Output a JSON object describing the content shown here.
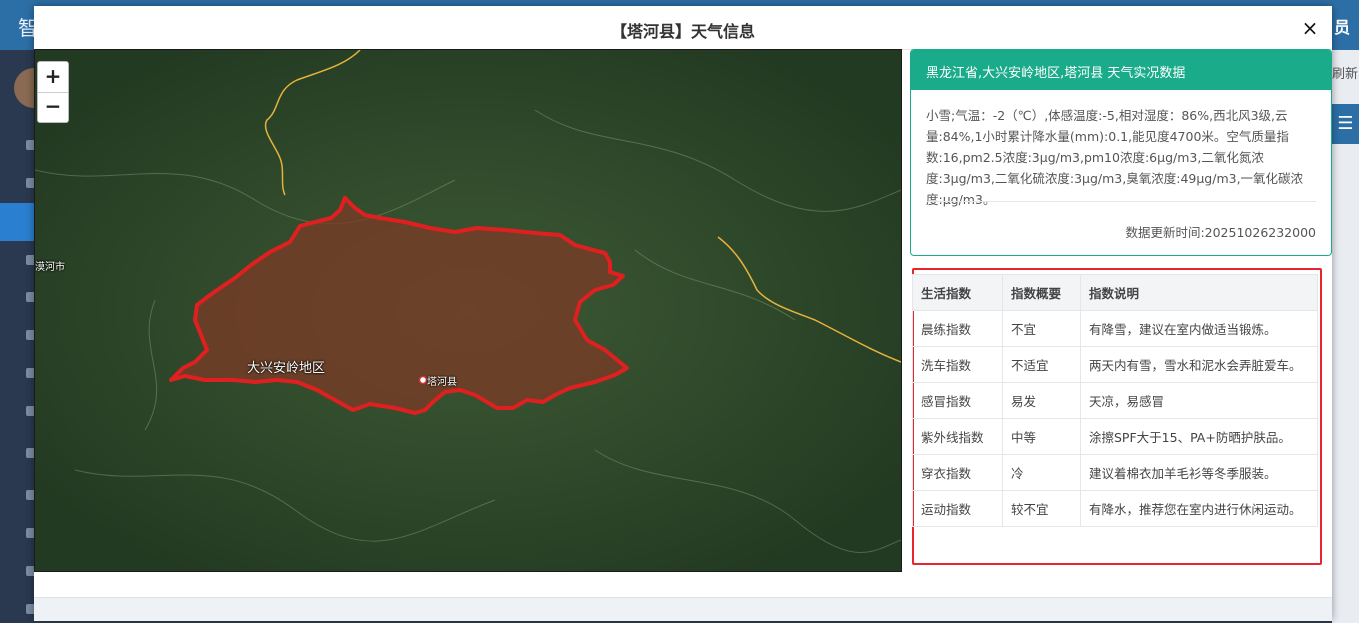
{
  "background": {
    "app_title": "智",
    "user_label": "员",
    "refresh_label": "刷新",
    "menu_icon": "hamburger-icon"
  },
  "modal": {
    "title": "【塔河县】天气信息",
    "close_label": "×"
  },
  "map": {
    "zoom_in_label": "+",
    "zoom_out_label": "−",
    "labels": {
      "mohe": "漠河市",
      "region": "大兴安岭地区",
      "county": "塔河县"
    },
    "boundary_color": "#e02020",
    "fill_color": "#7a3b26"
  },
  "weather": {
    "header": "黑龙江省,大兴安岭地区,塔河县 天气实况数据",
    "detail": "小雪;气温：-2（℃）,体感温度:-5,相对湿度：86%,西北风3级,云量:84%,1小时累计降水量(mm):0.1,能见度4700米。空气质量指数:16,pm2.5浓度:3μg/m3,pm10浓度:6μg/m3,二氧化氮浓度:3μg/m3,二氧化硫浓度:3μg/m3,臭氧浓度:49μg/m3,一氧化碳浓度:μg/m3。",
    "update_time": "数据更新时间:20251026232000",
    "accent_color": "#1aab8a"
  },
  "indices": {
    "headers": [
      "生活指数",
      "指数概要",
      "指数说明"
    ],
    "rows": [
      [
        "晨练指数",
        "不宜",
        "有降雪，建议在室内做适当锻炼。"
      ],
      [
        "洗车指数",
        "不适宜",
        "两天内有雪，雪水和泥水会弄脏爱车。"
      ],
      [
        "感冒指数",
        "易发",
        "天凉，易感冒"
      ],
      [
        "紫外线指数",
        "中等",
        "涂擦SPF大于15、PA+防晒护肤品。"
      ],
      [
        "穿衣指数",
        "冷",
        "建议着棉衣加羊毛衫等冬季服装。"
      ],
      [
        "运动指数",
        "较不宜",
        "有降水，推荐您在室内进行休闲运动。"
      ]
    ],
    "highlight_color": "#e8242c"
  }
}
